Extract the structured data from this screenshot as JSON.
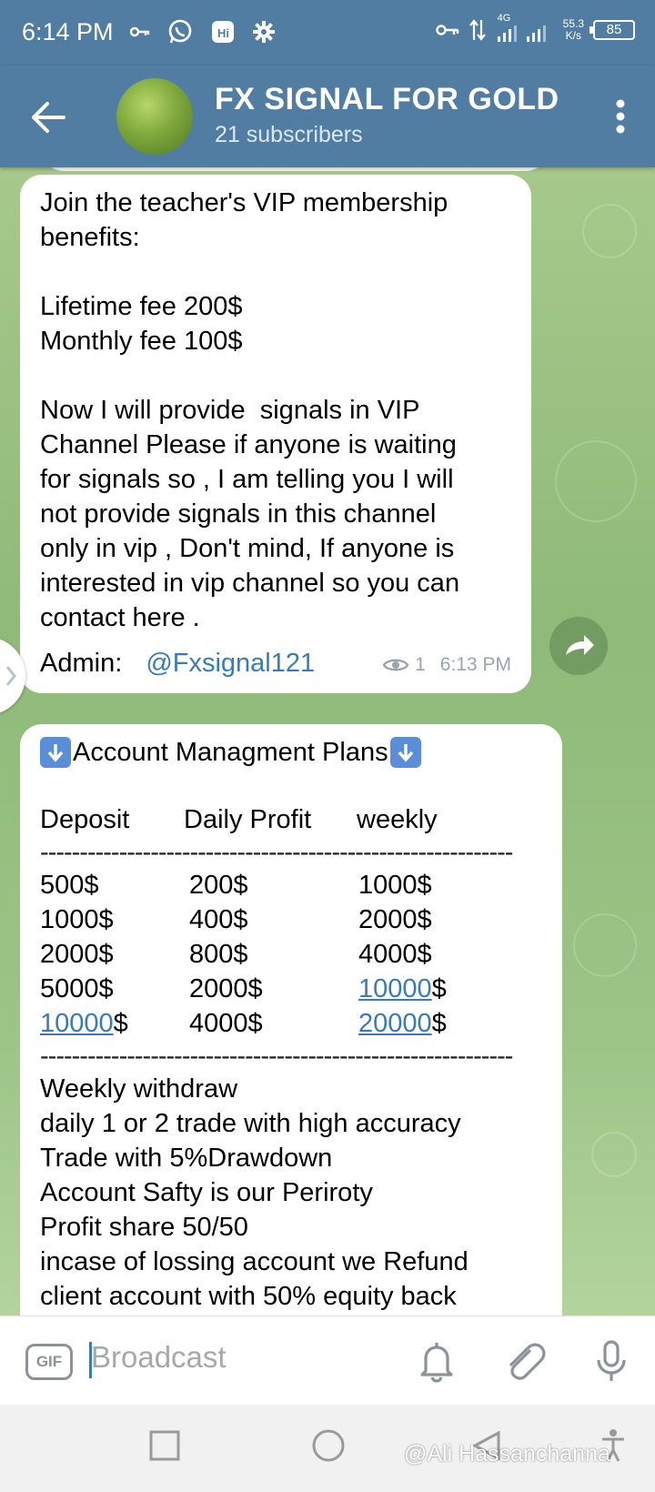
{
  "status_bar": {
    "time": "6:14 PM",
    "network_speed": "55.3",
    "network_unit": "K/s",
    "net_type": "4G",
    "battery": "85"
  },
  "header": {
    "title": "FX SIGNAL FOR GOLD",
    "subtitle": "21 subscribers"
  },
  "messages": {
    "vip": {
      "text": "Join the teacher's VIP membership\nbenefits:\n\nLifetime fee 200$\nMonthly fee 100$\n\nNow I will provide  signals in VIP\nChannel Please if anyone is waiting\nfor signals so , I am telling you I will\nnot provide signals in this channel\nonly in vip , Don't mind, If anyone is\ninterested in vip channel so you can\ncontact here .",
      "admin_label": "Admin:",
      "admin_link": "@Fxsignal121",
      "views": "1",
      "time": "6:13 PM"
    },
    "plans": {
      "title": "Account Managment Plans",
      "headers": [
        "Deposit",
        "Daily Profit",
        "weekly"
      ],
      "separator": "------------------------------------------------------------",
      "rows": [
        {
          "deposit": "500$",
          "deposit_link": "",
          "deposit_suffix": "",
          "daily": "200$",
          "weekly": "1000$",
          "weekly_link": "",
          "weekly_suffix": ""
        },
        {
          "deposit": "1000$",
          "deposit_link": "",
          "deposit_suffix": "",
          "daily": "400$",
          "weekly": "2000$",
          "weekly_link": "",
          "weekly_suffix": ""
        },
        {
          "deposit": "2000$",
          "deposit_link": "",
          "deposit_suffix": "",
          "daily": "800$",
          "weekly": "4000$",
          "weekly_link": "",
          "weekly_suffix": ""
        },
        {
          "deposit": "5000$",
          "deposit_link": "",
          "deposit_suffix": "",
          "daily": "2000$",
          "weekly": "",
          "weekly_link": "10000",
          "weekly_suffix": "$"
        },
        {
          "deposit": "",
          "deposit_link": "10000",
          "deposit_suffix": "$",
          "daily": "4000$",
          "weekly": "",
          "weekly_link": "20000",
          "weekly_suffix": "$"
        }
      ],
      "notes": [
        "Weekly withdraw",
        "daily 1 or 2 trade with high accuracy",
        "Trade with 5%Drawdown",
        "Account Safty is our Periroty",
        "Profit share 50/50",
        "incase of lossing account we Refund",
        "client account with 50% equity back"
      ]
    }
  },
  "composer": {
    "gif_label": "GIF",
    "placeholder": "Broadcast"
  },
  "watermark": "@Ali Hassanchanna",
  "colors": {
    "header": "#517da2",
    "link": "#3a7bb5",
    "chat_bg": "#8fb67c"
  }
}
